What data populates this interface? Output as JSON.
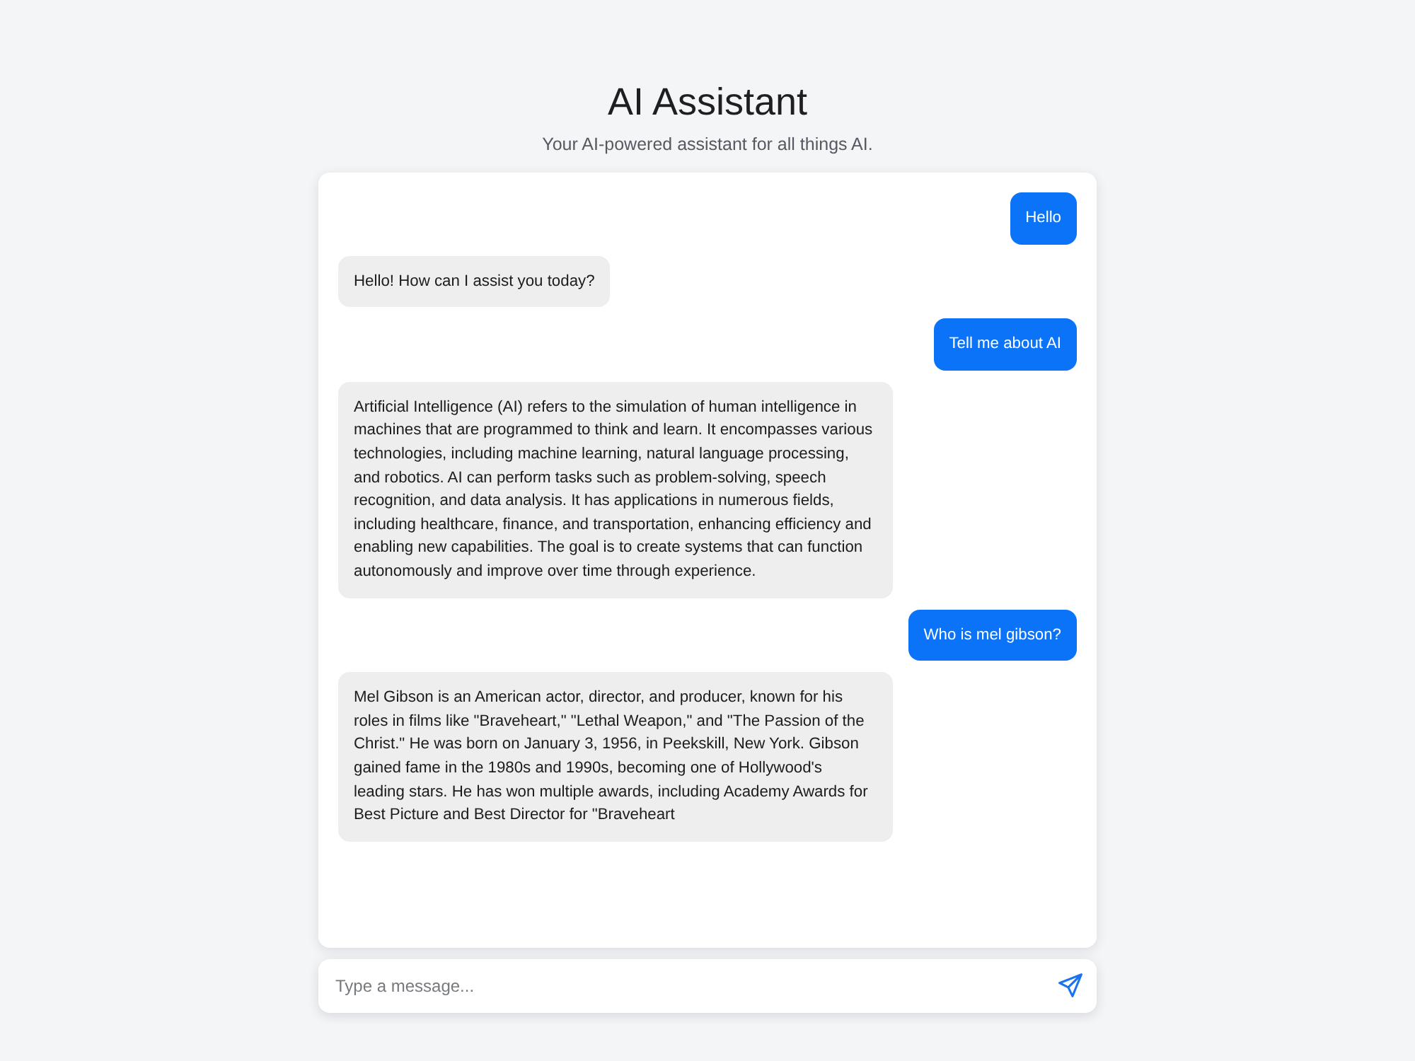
{
  "header": {
    "title": "AI Assistant",
    "subtitle": "Your AI-powered assistant for all things AI."
  },
  "messages": [
    {
      "kind": "user",
      "text": "Hello"
    },
    {
      "kind": "assistant",
      "text": "Hello! How can I assist you today?"
    },
    {
      "kind": "user",
      "text": "Tell me about AI"
    },
    {
      "kind": "assistant",
      "text": "Artificial Intelligence (AI) refers to the simulation of human intelligence in machines that are programmed to think and learn. It encompasses various technologies, including machine learning, natural language processing, and robotics. AI can perform tasks such as problem-solving, speech recognition, and data analysis. It has applications in numerous fields, including healthcare, finance, and transportation, enhancing efficiency and enabling new capabilities. The goal is to create systems that can function autonomously and improve over time through experience."
    },
    {
      "kind": "user",
      "text": "Who is mel gibson?"
    },
    {
      "kind": "assistant",
      "text": "Mel Gibson is an American actor, director, and producer, known for his roles in films like \"Braveheart,\" \"Lethal Weapon,\" and \"The Passion of the Christ.\" He was born on January 3, 1956, in Peekskill, New York. Gibson gained fame in the 1980s and 1990s, becoming one of Hollywood's leading stars. He has won multiple awards, including Academy Awards for Best Picture and Best Director for \"Braveheart"
    }
  ],
  "composer": {
    "placeholder": "Type a message..."
  }
}
